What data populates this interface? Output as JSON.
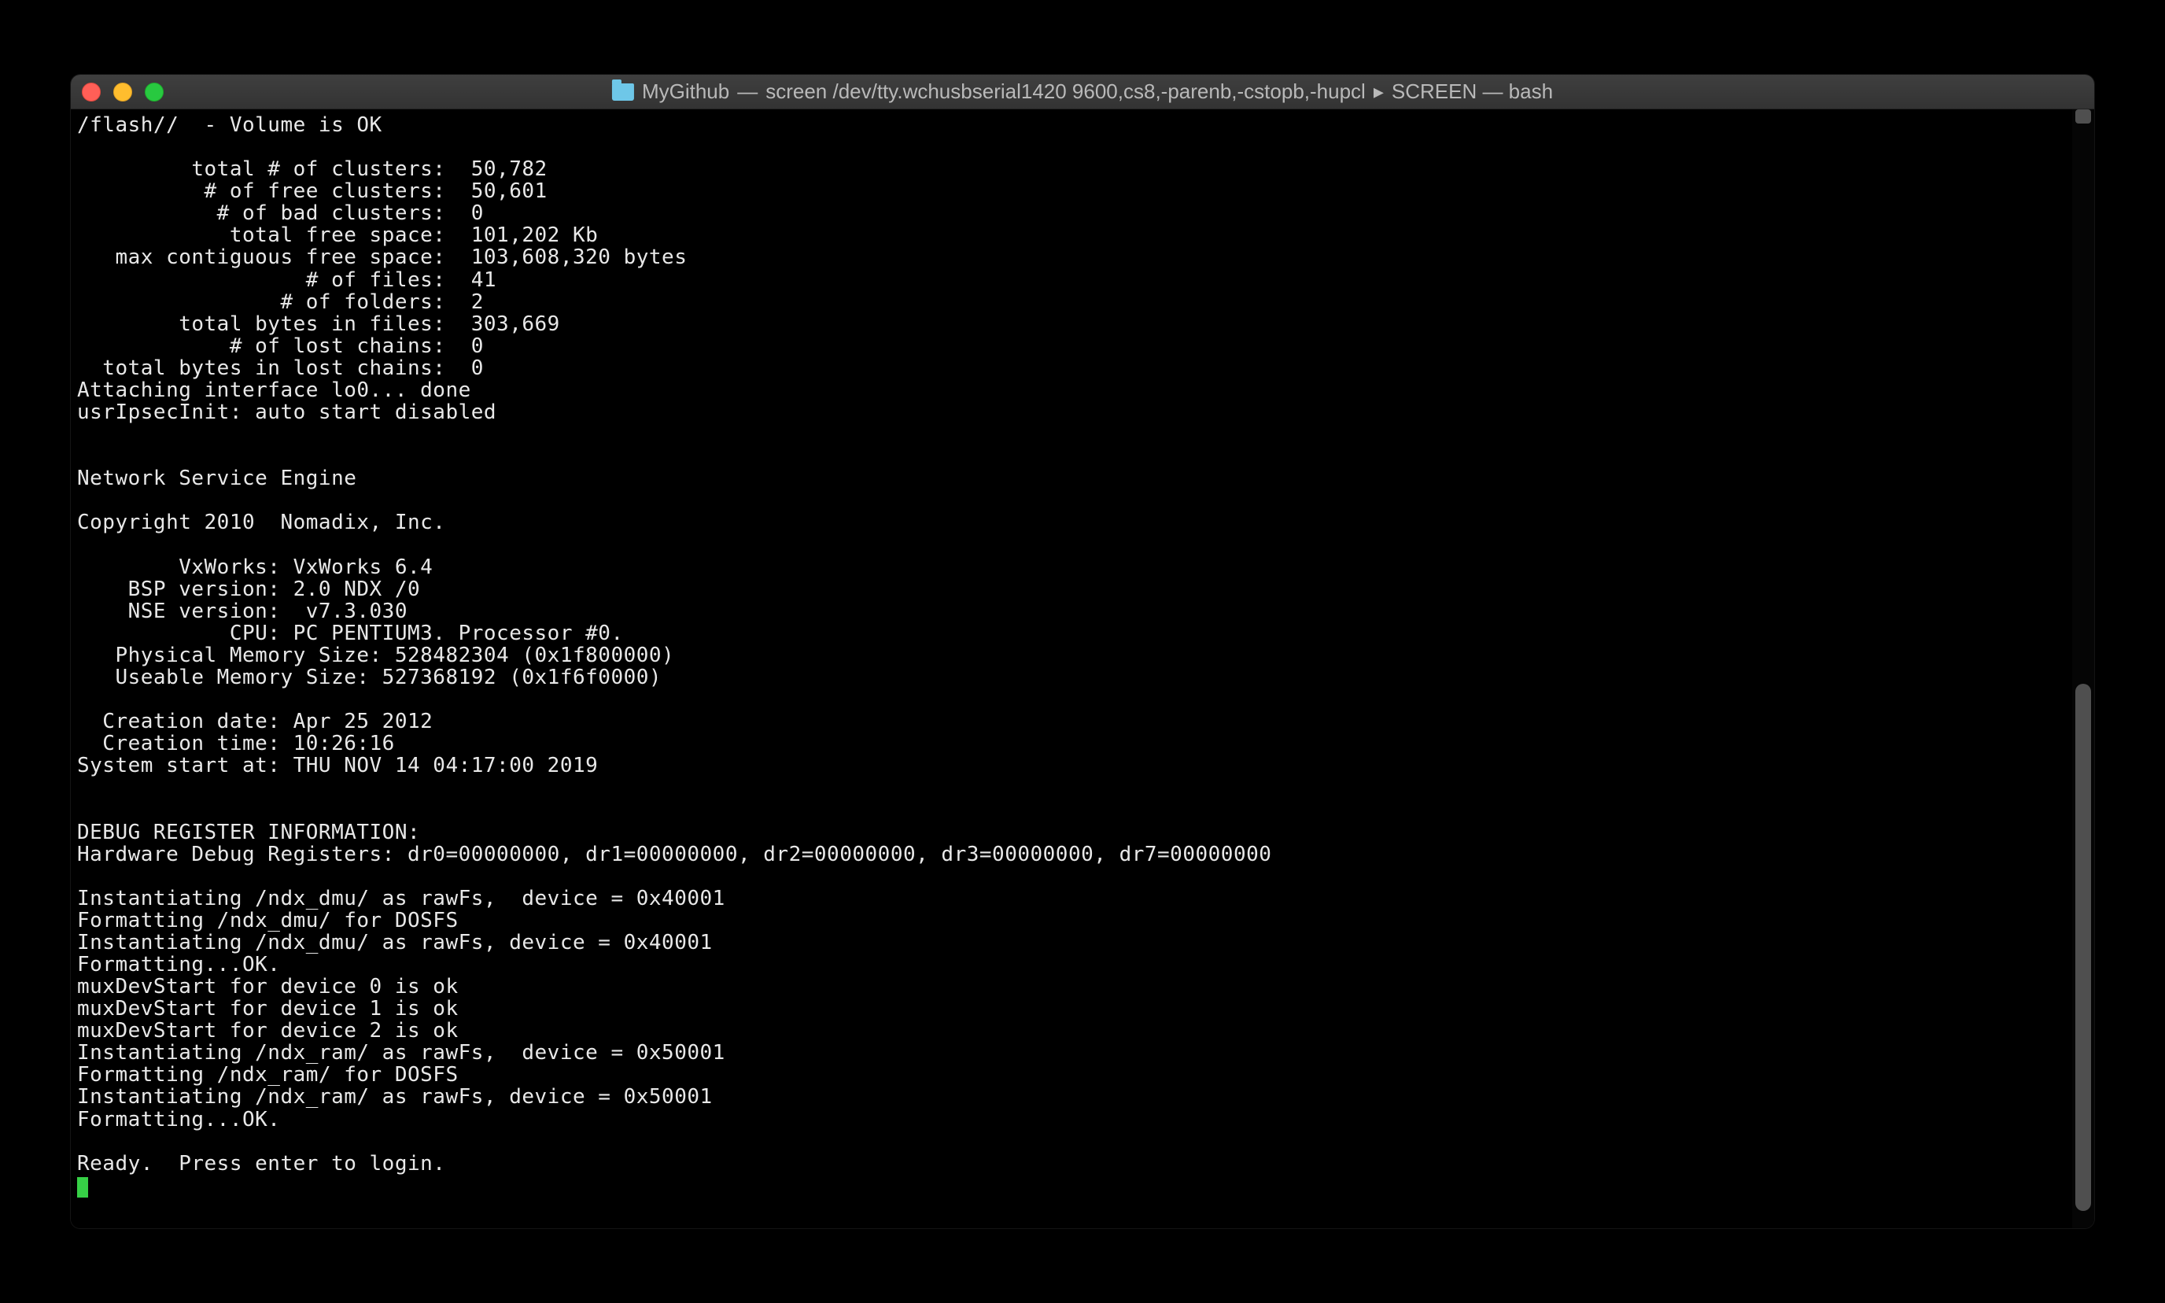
{
  "titlebar": {
    "folder_name": "MyGithub",
    "sep1": " — ",
    "process": "screen /dev/tty.wchusbserial1420 9600,cs8,-parenb,-cstopb,-hupcl",
    "arrow": " ▸ ",
    "right": "SCREEN — bash"
  },
  "terminal": {
    "lines": [
      "/flash//  - Volume is OK",
      "",
      "         total # of clusters:  50,782",
      "          # of free clusters:  50,601",
      "           # of bad clusters:  0",
      "            total free space:  101,202 Kb",
      "   max contiguous free space:  103,608,320 bytes",
      "                  # of files:  41",
      "                # of folders:  2",
      "        total bytes in files:  303,669",
      "            # of lost chains:  0",
      "  total bytes in lost chains:  0",
      "Attaching interface lo0... done",
      "usrIpsecInit: auto start disabled",
      "",
      "",
      "Network Service Engine",
      "",
      "Copyright 2010  Nomadix, Inc.",
      "",
      "        VxWorks: VxWorks 6.4",
      "    BSP version: 2.0 NDX /0",
      "    NSE version:  v7.3.030",
      "            CPU: PC PENTIUM3. Processor #0.",
      "   Physical Memory Size: 528482304 (0x1f800000)",
      "   Useable Memory Size: 527368192 (0x1f6f0000)",
      "",
      "  Creation date: Apr 25 2012",
      "  Creation time: 10:26:16",
      "System start at: THU NOV 14 04:17:00 2019",
      "",
      "",
      "DEBUG REGISTER INFORMATION:",
      "Hardware Debug Registers: dr0=00000000, dr1=00000000, dr2=00000000, dr3=00000000, dr7=00000000",
      "",
      "Instantiating /ndx_dmu/ as rawFs,  device = 0x40001",
      "Formatting /ndx_dmu/ for DOSFS",
      "Instantiating /ndx_dmu/ as rawFs, device = 0x40001",
      "Formatting...OK.",
      "muxDevStart for device 0 is ok",
      "muxDevStart for device 1 is ok",
      "muxDevStart for device 2 is ok",
      "Instantiating /ndx_ram/ as rawFs,  device = 0x50001",
      "Formatting /ndx_ram/ for DOSFS",
      "Instantiating /ndx_ram/ as rawFs, device = 0x50001",
      "Formatting...OK.",
      "",
      "Ready.  Press enter to login."
    ]
  }
}
